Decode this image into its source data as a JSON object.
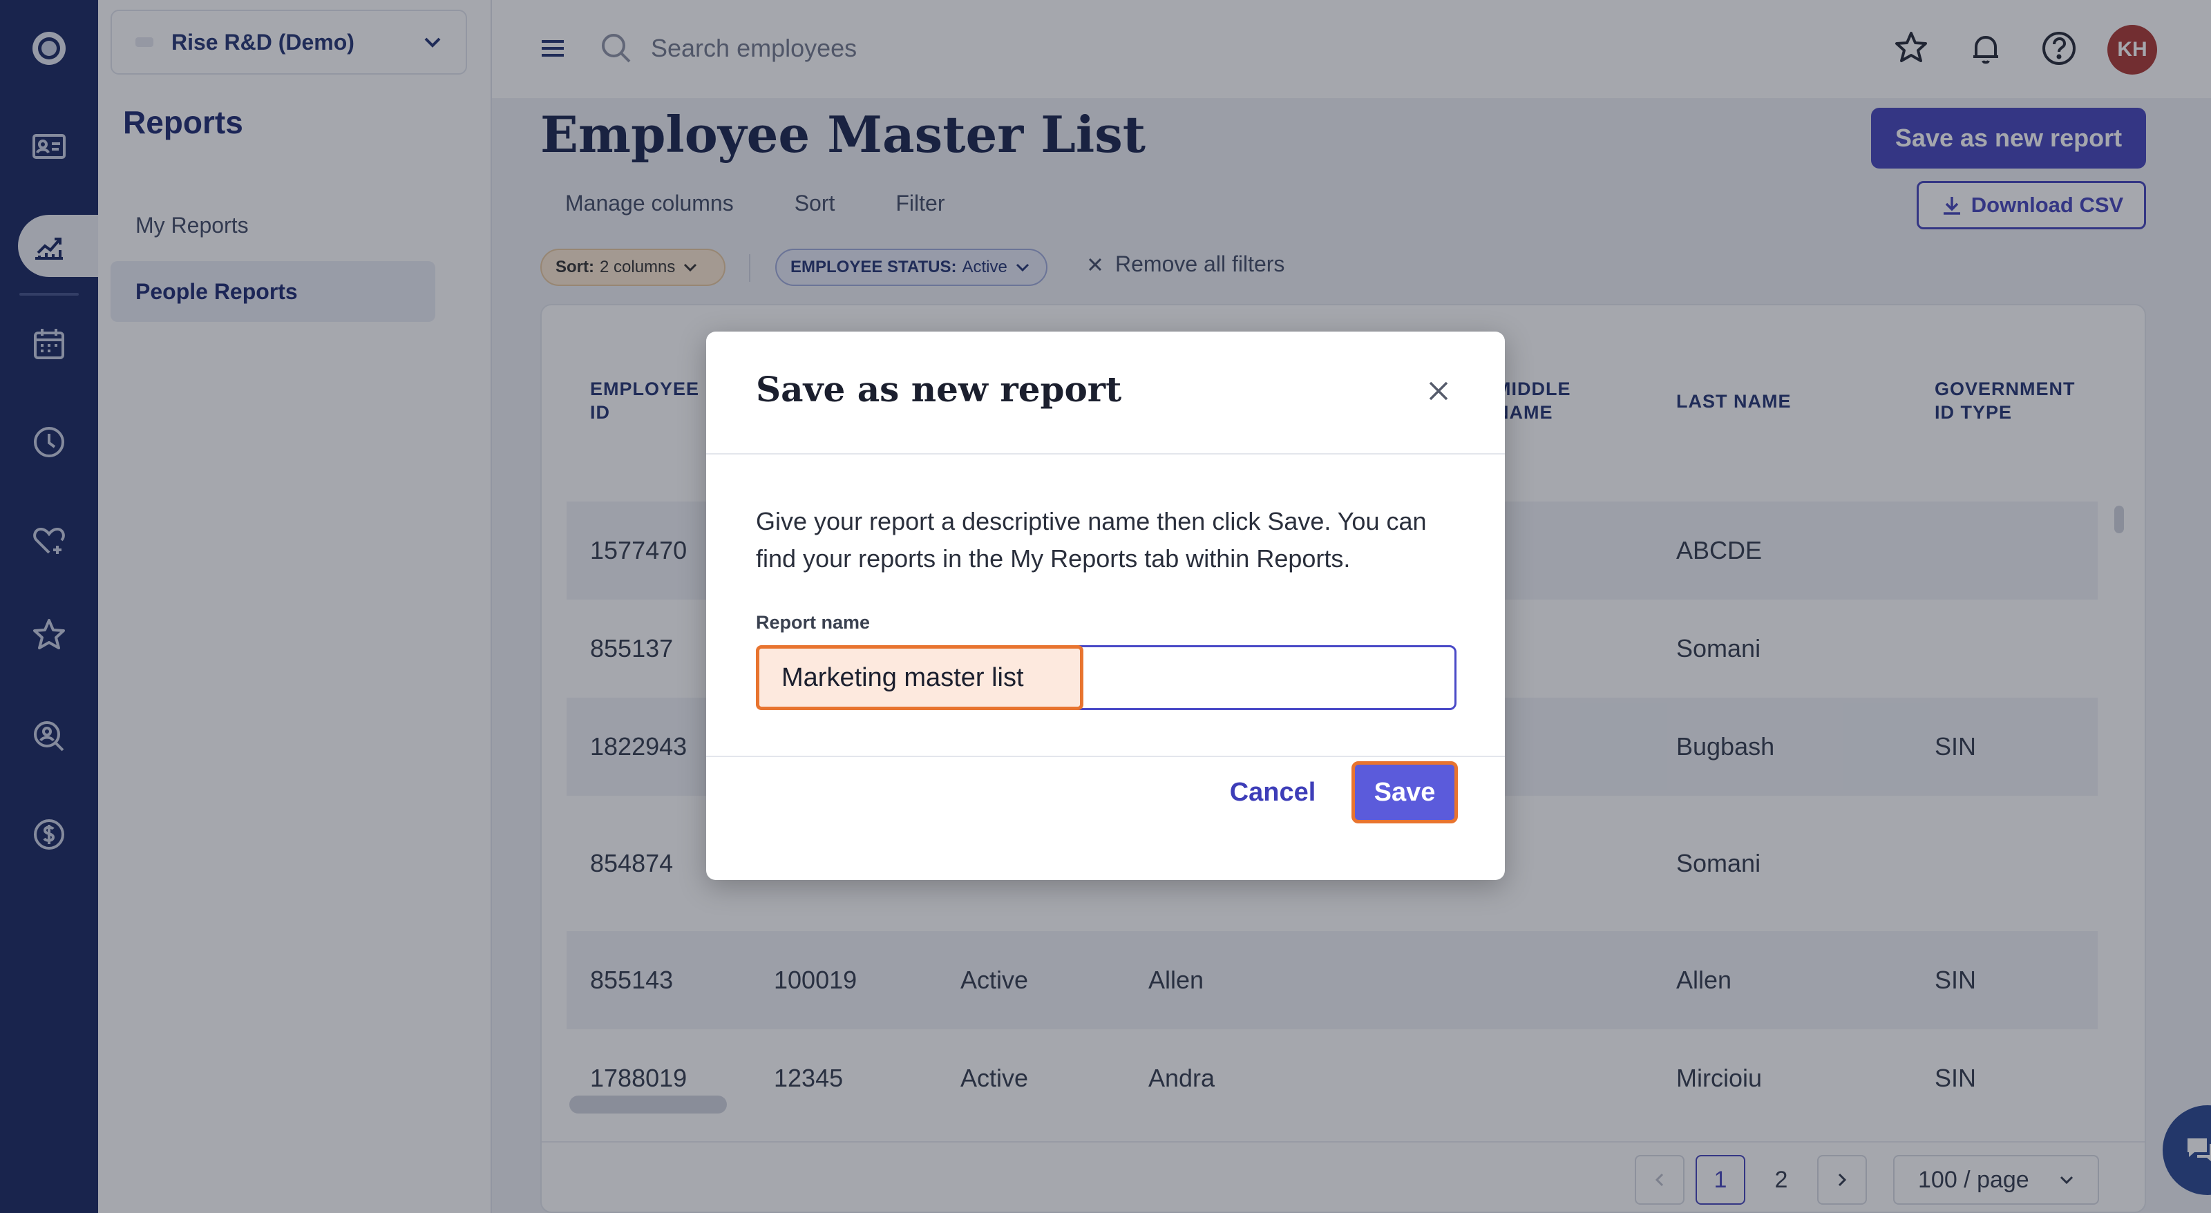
{
  "company": {
    "name": "Rise R&D (Demo)"
  },
  "sidebar": {
    "title": "Reports",
    "items": [
      {
        "label": "My Reports",
        "active": false
      },
      {
        "label": "People Reports",
        "active": true
      }
    ]
  },
  "rail": {
    "icons": [
      "logo-icon",
      "people-card-icon",
      "reports-chart-icon",
      "calendar-icon",
      "clock-icon",
      "heart-plus-icon",
      "star-icon",
      "person-search-icon",
      "dollar-icon"
    ]
  },
  "topbar": {
    "search_placeholder": "Search employees",
    "avatar_initials": "KH"
  },
  "page": {
    "title": "Employee Master List",
    "save_new_label": "Save as new report",
    "download_label": "Download CSV",
    "tabs": [
      "Manage columns",
      "Sort",
      "Filter"
    ],
    "chips": {
      "sort_key": "Sort:",
      "sort_value": "2 columns",
      "status_key": "EMPLOYEE STATUS:",
      "status_value": "Active"
    },
    "remove_filters_label": "Remove all filters"
  },
  "table": {
    "headers": {
      "employee_id": [
        "EMPLOYEE",
        "ID"
      ],
      "middle_name": [
        "MIDDLE",
        "NAME"
      ],
      "last_name": "LAST NAME",
      "gov_id_type": [
        "GOVERNMENT",
        "ID TYPE"
      ]
    },
    "rows": [
      {
        "employee_id": "1577470",
        "col2": "",
        "status": "",
        "first": "",
        "last": "ABCDE",
        "gov": ""
      },
      {
        "employee_id": "855137",
        "col2": "",
        "status": "",
        "first": "",
        "last": "Somani",
        "gov": ""
      },
      {
        "employee_id": "1822943",
        "col2": "",
        "status": "",
        "first": "",
        "last": "Bugbash",
        "gov": "SIN"
      },
      {
        "employee_id": "854874",
        "col2": "",
        "status": "",
        "first": "",
        "last": "Somani",
        "gov": ""
      },
      {
        "employee_id": "855143",
        "col2": "100019",
        "status": "Active",
        "first": "Allen",
        "last": "Allen",
        "gov": "SIN"
      },
      {
        "employee_id": "1788019",
        "col2": "12345",
        "status": "Active",
        "first": "Andra",
        "last": "Mircioiu",
        "gov": "SIN"
      }
    ]
  },
  "pagination": {
    "pages": [
      "1",
      "2"
    ],
    "current": "1",
    "page_size": "100 / page"
  },
  "modal": {
    "title": "Save as new report",
    "description": "Give your report a descriptive name then click Save. You can find your reports in the My Reports tab within Reports.",
    "field_label": "Report name",
    "field_value": "Marketing master list",
    "cancel_label": "Cancel",
    "save_label": "Save"
  },
  "colors": {
    "rail_bg": "#0f1e5a",
    "primary": "#3d3db8",
    "highlight": "#e8742f",
    "avatar": "#a8302a"
  }
}
